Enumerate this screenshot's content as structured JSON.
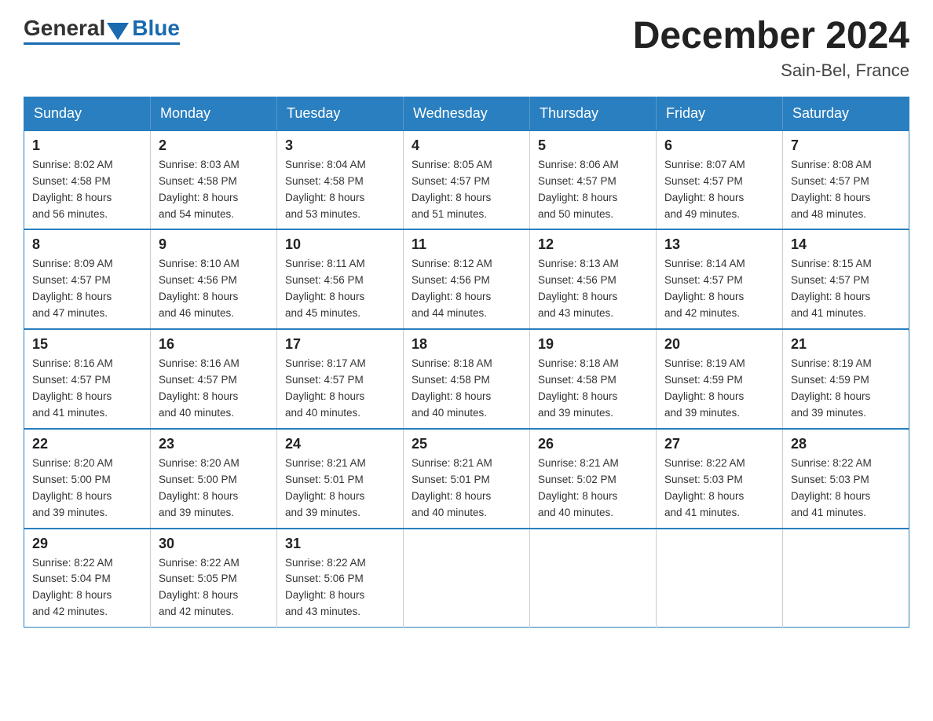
{
  "logo": {
    "general": "General",
    "blue": "Blue"
  },
  "header": {
    "title": "December 2024",
    "subtitle": "Sain-Bel, France"
  },
  "days_of_week": [
    "Sunday",
    "Monday",
    "Tuesday",
    "Wednesday",
    "Thursday",
    "Friday",
    "Saturday"
  ],
  "weeks": [
    [
      {
        "day": "1",
        "sunrise": "8:02 AM",
        "sunset": "4:58 PM",
        "daylight": "8 hours and 56 minutes."
      },
      {
        "day": "2",
        "sunrise": "8:03 AM",
        "sunset": "4:58 PM",
        "daylight": "8 hours and 54 minutes."
      },
      {
        "day": "3",
        "sunrise": "8:04 AM",
        "sunset": "4:58 PM",
        "daylight": "8 hours and 53 minutes."
      },
      {
        "day": "4",
        "sunrise": "8:05 AM",
        "sunset": "4:57 PM",
        "daylight": "8 hours and 51 minutes."
      },
      {
        "day": "5",
        "sunrise": "8:06 AM",
        "sunset": "4:57 PM",
        "daylight": "8 hours and 50 minutes."
      },
      {
        "day": "6",
        "sunrise": "8:07 AM",
        "sunset": "4:57 PM",
        "daylight": "8 hours and 49 minutes."
      },
      {
        "day": "7",
        "sunrise": "8:08 AM",
        "sunset": "4:57 PM",
        "daylight": "8 hours and 48 minutes."
      }
    ],
    [
      {
        "day": "8",
        "sunrise": "8:09 AM",
        "sunset": "4:57 PM",
        "daylight": "8 hours and 47 minutes."
      },
      {
        "day": "9",
        "sunrise": "8:10 AM",
        "sunset": "4:56 PM",
        "daylight": "8 hours and 46 minutes."
      },
      {
        "day": "10",
        "sunrise": "8:11 AM",
        "sunset": "4:56 PM",
        "daylight": "8 hours and 45 minutes."
      },
      {
        "day": "11",
        "sunrise": "8:12 AM",
        "sunset": "4:56 PM",
        "daylight": "8 hours and 44 minutes."
      },
      {
        "day": "12",
        "sunrise": "8:13 AM",
        "sunset": "4:56 PM",
        "daylight": "8 hours and 43 minutes."
      },
      {
        "day": "13",
        "sunrise": "8:14 AM",
        "sunset": "4:57 PM",
        "daylight": "8 hours and 42 minutes."
      },
      {
        "day": "14",
        "sunrise": "8:15 AM",
        "sunset": "4:57 PM",
        "daylight": "8 hours and 41 minutes."
      }
    ],
    [
      {
        "day": "15",
        "sunrise": "8:16 AM",
        "sunset": "4:57 PM",
        "daylight": "8 hours and 41 minutes."
      },
      {
        "day": "16",
        "sunrise": "8:16 AM",
        "sunset": "4:57 PM",
        "daylight": "8 hours and 40 minutes."
      },
      {
        "day": "17",
        "sunrise": "8:17 AM",
        "sunset": "4:57 PM",
        "daylight": "8 hours and 40 minutes."
      },
      {
        "day": "18",
        "sunrise": "8:18 AM",
        "sunset": "4:58 PM",
        "daylight": "8 hours and 40 minutes."
      },
      {
        "day": "19",
        "sunrise": "8:18 AM",
        "sunset": "4:58 PM",
        "daylight": "8 hours and 39 minutes."
      },
      {
        "day": "20",
        "sunrise": "8:19 AM",
        "sunset": "4:59 PM",
        "daylight": "8 hours and 39 minutes."
      },
      {
        "day": "21",
        "sunrise": "8:19 AM",
        "sunset": "4:59 PM",
        "daylight": "8 hours and 39 minutes."
      }
    ],
    [
      {
        "day": "22",
        "sunrise": "8:20 AM",
        "sunset": "5:00 PM",
        "daylight": "8 hours and 39 minutes."
      },
      {
        "day": "23",
        "sunrise": "8:20 AM",
        "sunset": "5:00 PM",
        "daylight": "8 hours and 39 minutes."
      },
      {
        "day": "24",
        "sunrise": "8:21 AM",
        "sunset": "5:01 PM",
        "daylight": "8 hours and 39 minutes."
      },
      {
        "day": "25",
        "sunrise": "8:21 AM",
        "sunset": "5:01 PM",
        "daylight": "8 hours and 40 minutes."
      },
      {
        "day": "26",
        "sunrise": "8:21 AM",
        "sunset": "5:02 PM",
        "daylight": "8 hours and 40 minutes."
      },
      {
        "day": "27",
        "sunrise": "8:22 AM",
        "sunset": "5:03 PM",
        "daylight": "8 hours and 41 minutes."
      },
      {
        "day": "28",
        "sunrise": "8:22 AM",
        "sunset": "5:03 PM",
        "daylight": "8 hours and 41 minutes."
      }
    ],
    [
      {
        "day": "29",
        "sunrise": "8:22 AM",
        "sunset": "5:04 PM",
        "daylight": "8 hours and 42 minutes."
      },
      {
        "day": "30",
        "sunrise": "8:22 AM",
        "sunset": "5:05 PM",
        "daylight": "8 hours and 42 minutes."
      },
      {
        "day": "31",
        "sunrise": "8:22 AM",
        "sunset": "5:06 PM",
        "daylight": "8 hours and 43 minutes."
      },
      null,
      null,
      null,
      null
    ]
  ],
  "labels": {
    "sunrise": "Sunrise:",
    "sunset": "Sunset:",
    "daylight": "Daylight:"
  }
}
